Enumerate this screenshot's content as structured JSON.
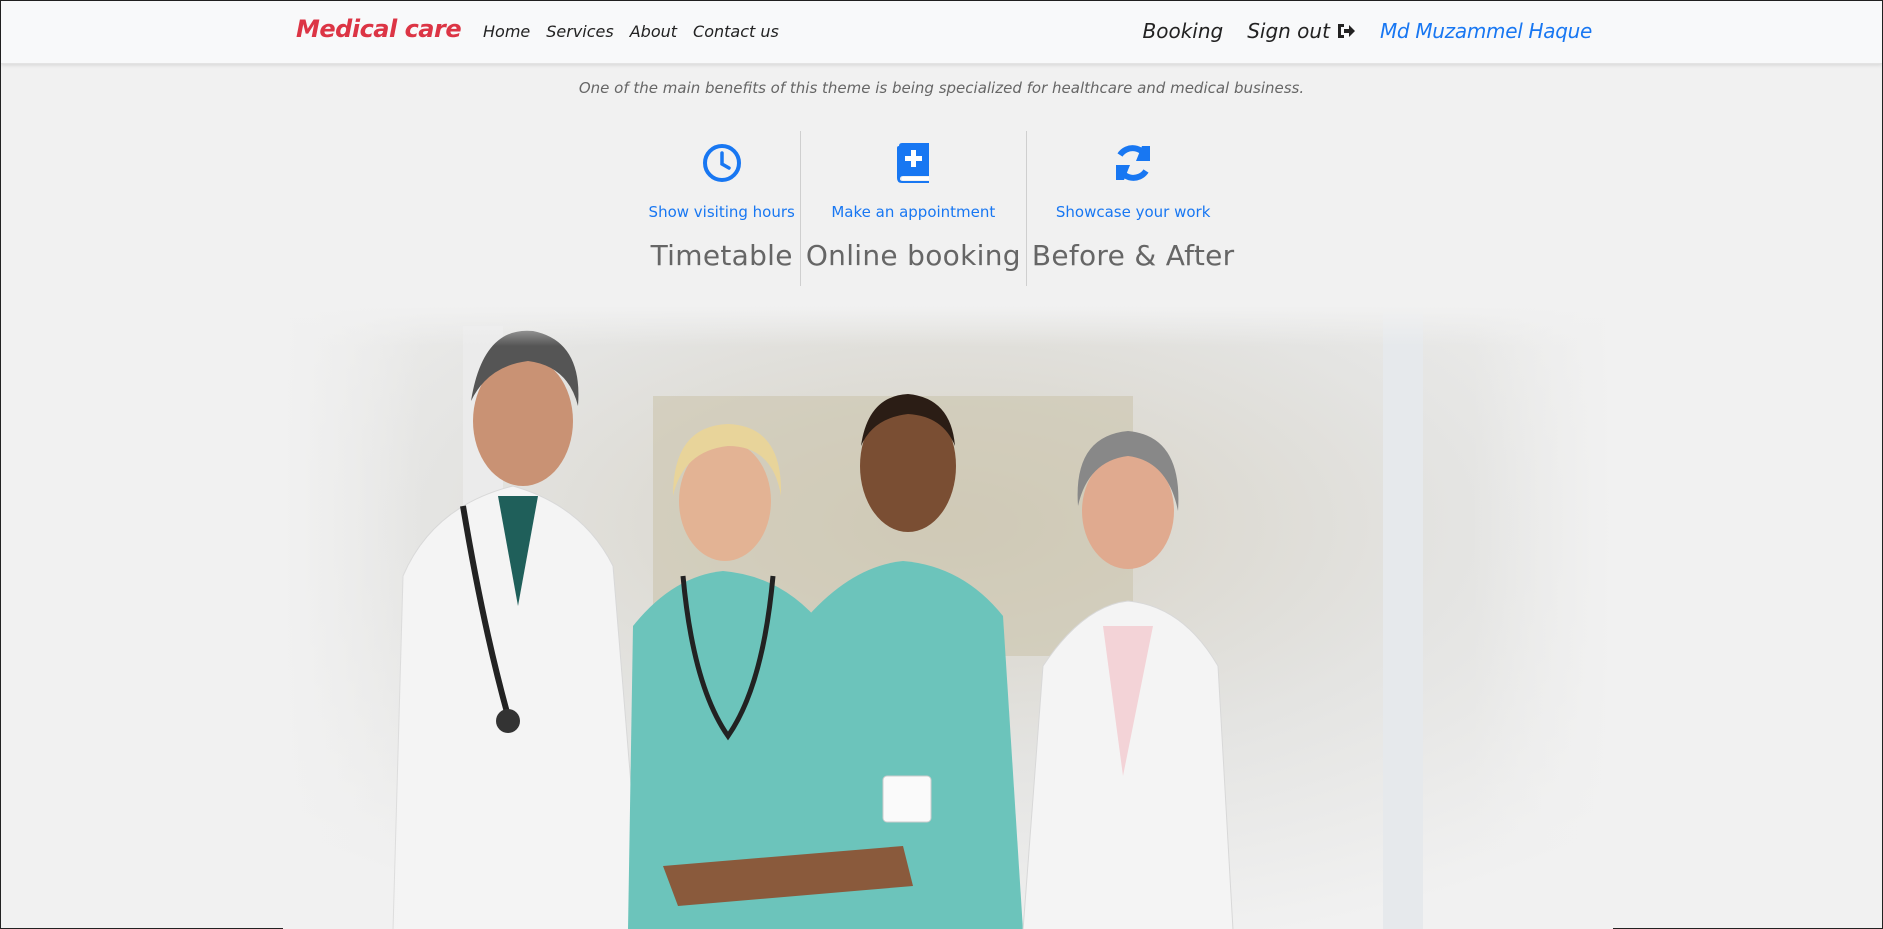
{
  "navbar": {
    "brand": "Medical care",
    "links": [
      "Home",
      "Services",
      "About",
      "Contact us"
    ],
    "booking": "Booking",
    "signout": "Sign out",
    "user": "Md Muzammel Haque"
  },
  "tagline": "One of the main benefits of this theme is being specialized for healthcare and medical business.",
  "features": [
    {
      "icon": "clock-icon",
      "sub": "Show visiting hours",
      "title": "Timetable"
    },
    {
      "icon": "medical-book-icon",
      "sub": "Make an appointment",
      "title": "Online booking"
    },
    {
      "icon": "refresh-icon",
      "sub": "Showcase your work",
      "title": "Before & After"
    }
  ],
  "colors": {
    "brand": "#dc3545",
    "accent": "#1877f2",
    "background": "#f1f1f1"
  }
}
